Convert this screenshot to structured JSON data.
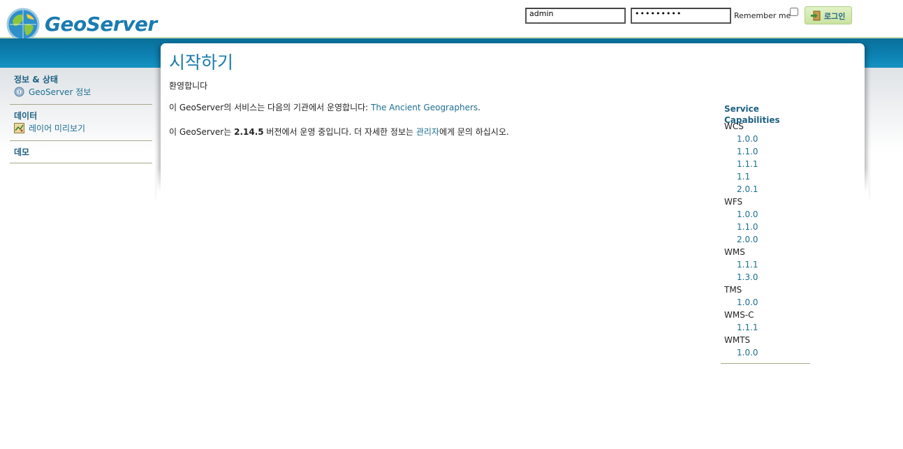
{
  "header": {
    "logo_text": "GeoServer",
    "username": "admin",
    "password": "•••••••••",
    "remember_label": "Remember me",
    "login_label": "로그인"
  },
  "sidebar": {
    "sections": [
      {
        "heading": "정보 & 상태",
        "items": [
          {
            "label": "GeoServer 정보",
            "icon": "info-globe-icon"
          }
        ]
      },
      {
        "heading": "데이터",
        "items": [
          {
            "label": "레이어 미리보기",
            "icon": "layer-preview-icon"
          }
        ]
      },
      {
        "heading": "데모",
        "items": []
      }
    ]
  },
  "main": {
    "title": "시작하기",
    "welcome": "환영합니다",
    "service_prefix": "이 GeoServer의 서비스는 다음의 기관에서 운영합니다: ",
    "org_link": "The Ancient Geographers",
    "service_suffix": ".",
    "version_prefix": "이 GeoServer는 ",
    "version": "2.14.5",
    "version_middle": " 버전에서 운영 중입니다. 더 자세한 정보는 ",
    "admin_link": "관리자",
    "version_suffix": "에게 문의 하십시오."
  },
  "capabilities": {
    "title": "Service Capabilities",
    "services": [
      {
        "name": "WCS",
        "versions": [
          "1.0.0",
          "1.1.0",
          "1.1.1",
          "1.1",
          "2.0.1"
        ]
      },
      {
        "name": "WFS",
        "versions": [
          "1.0.0",
          "1.1.0",
          "2.0.0"
        ]
      },
      {
        "name": "WMS",
        "versions": [
          "1.1.1",
          "1.3.0"
        ]
      },
      {
        "name": "TMS",
        "versions": [
          "1.0.0"
        ]
      },
      {
        "name": "WMS-C",
        "versions": [
          "1.1.1"
        ]
      },
      {
        "name": "WMTS",
        "versions": [
          "1.0.0"
        ]
      }
    ]
  },
  "colors": {
    "accent": "#1c7bab",
    "band": "#0c82b3",
    "link": "#1c6e91"
  }
}
